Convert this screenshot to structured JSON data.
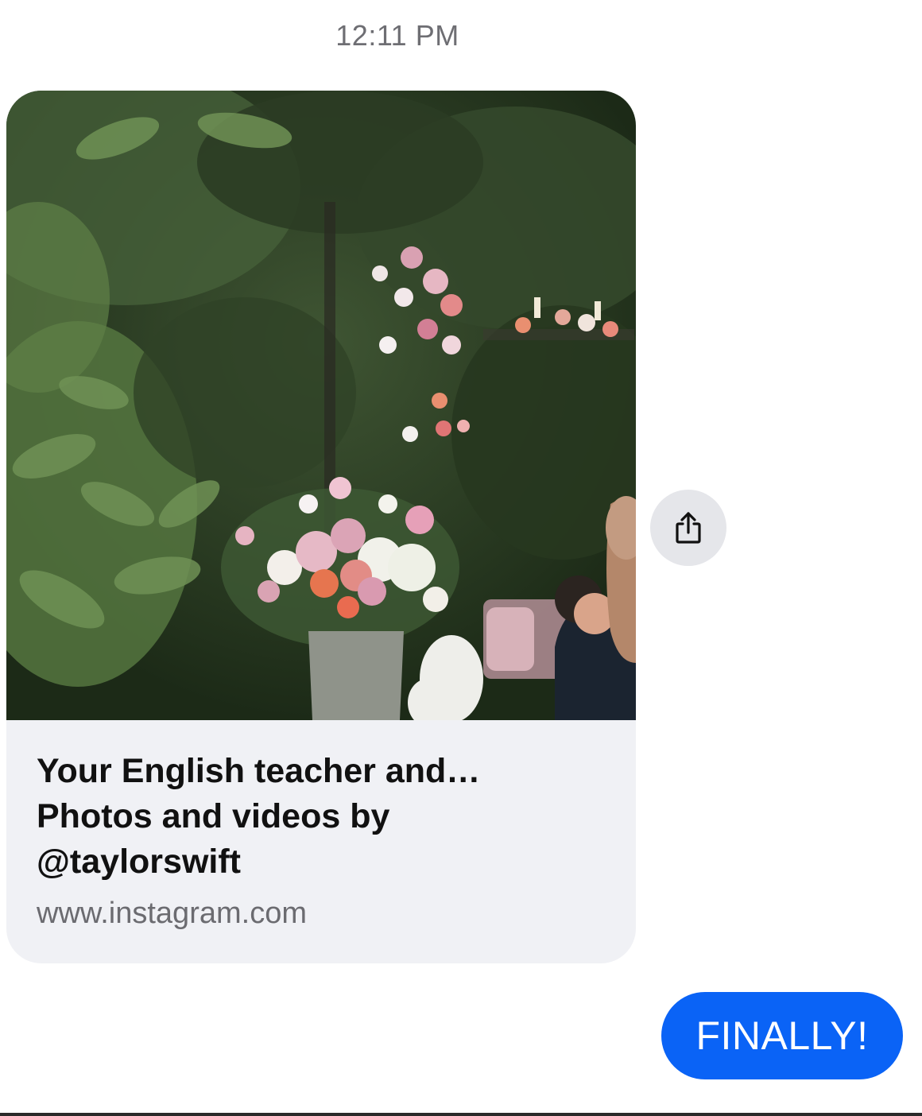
{
  "thread": {
    "timestamp": "12:11 PM"
  },
  "link_preview": {
    "title": "Your English teacher and…\nPhotos and videos by\n@taylorswift",
    "domain": "www.instagram.com",
    "image_description_icon": "garden-flowers-photo"
  },
  "share": {
    "icon": "share-icon"
  },
  "sent_message": {
    "text": "FINALLY!",
    "color": "#0a63f6"
  }
}
